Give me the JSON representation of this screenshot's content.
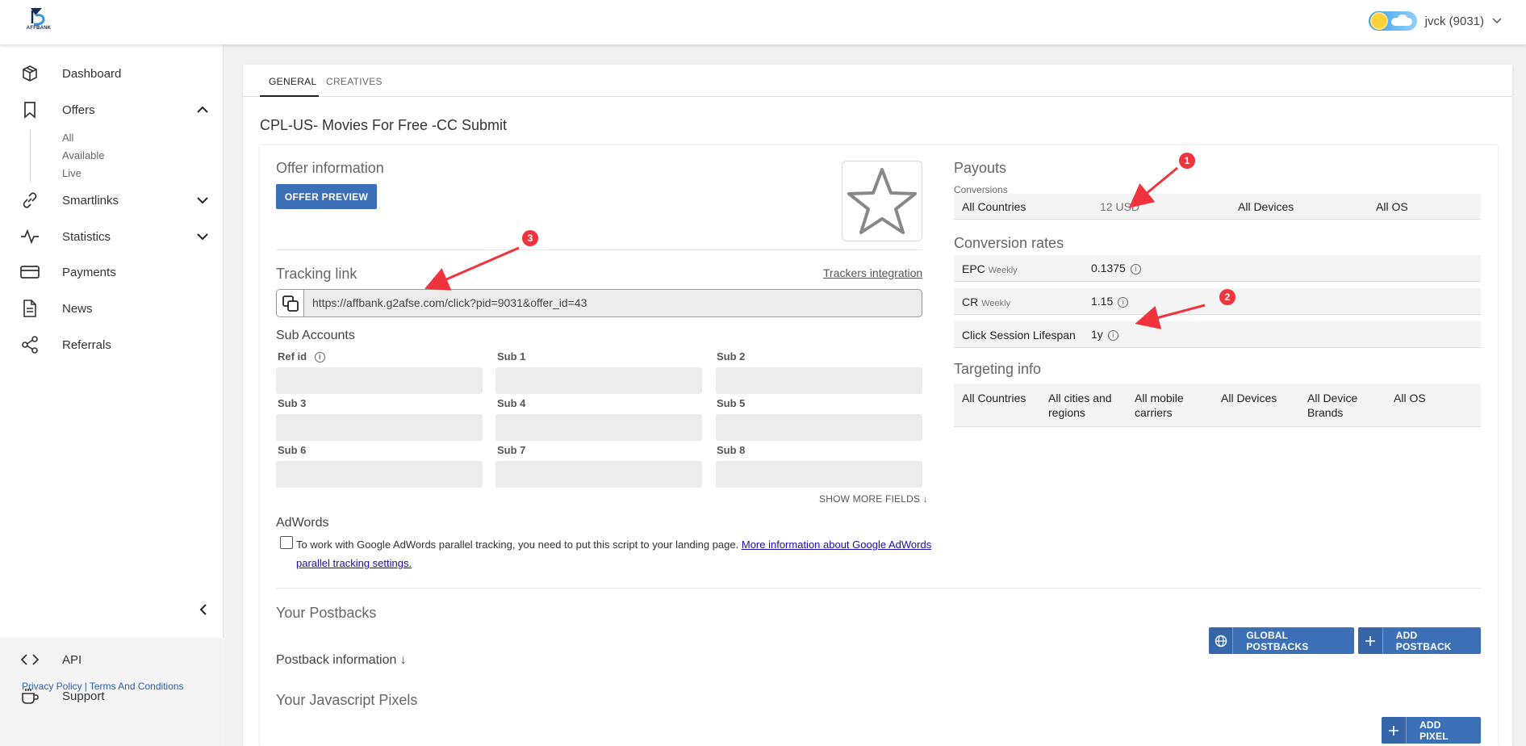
{
  "logo": {
    "text": "AFFBANK"
  },
  "user": {
    "name": "jvck (9031)"
  },
  "sidebar": {
    "items": [
      {
        "label": "Dashboard",
        "icon": "cube-icon"
      },
      {
        "label": "Offers",
        "icon": "bookmark-icon"
      },
      {
        "label": "Smartlinks",
        "icon": "link-icon"
      },
      {
        "label": "Statistics",
        "icon": "activity-icon"
      },
      {
        "label": "Payments",
        "icon": "credit-card-icon"
      },
      {
        "label": "News",
        "icon": "document-icon"
      },
      {
        "label": "Referrals",
        "icon": "share-icon"
      }
    ],
    "offers_sub": [
      "All",
      "Available",
      "Live"
    ],
    "bottom": [
      {
        "label": "API",
        "icon": "code-icon"
      },
      {
        "label": "Support",
        "icon": "coffee-icon"
      }
    ],
    "footer": {
      "privacy": "Privacy Policy",
      "sep": "|",
      "terms": "Terms And Conditions"
    }
  },
  "tabs": [
    "GENERAL",
    "CREATIVES"
  ],
  "offer": {
    "title": "CPL-US- Movies For Free -CC Submit"
  },
  "offer_info": {
    "heading": "Offer information",
    "preview_button": "OFFER PREVIEW"
  },
  "tracking": {
    "heading": "Tracking link",
    "integration_link": "Trackers integration",
    "url": "https://affbank.g2afse.com/click?pid=9031&offer_id=43"
  },
  "sub_accounts": {
    "heading": "Sub Accounts",
    "fields": [
      "Ref id",
      "Sub 1",
      "Sub 2",
      "Sub 3",
      "Sub 4",
      "Sub 5",
      "Sub 6",
      "Sub 7",
      "Sub 8"
    ],
    "show_more": "SHOW MORE FIELDS"
  },
  "adwords": {
    "heading": "AdWords",
    "text": "To work with Google AdWords parallel tracking, you need to put this script to your landing page.",
    "link": "More information about Google AdWords parallel tracking settings."
  },
  "payouts": {
    "heading": "Payouts",
    "subheading": "Conversions",
    "row": [
      "All Countries",
      "12 USD",
      "All Devices",
      "All OS"
    ]
  },
  "conversion_rates": {
    "heading": "Conversion rates",
    "epc_label": "EPC",
    "epc_period": "Weekly",
    "epc_value": "0.1375",
    "cr_label": "CR",
    "cr_period": "Weekly",
    "cr_value": "1.15",
    "session_label": "Click Session Lifespan",
    "session_value": "1y"
  },
  "targeting": {
    "heading": "Targeting info",
    "cells": [
      "All Countries",
      "All cities and regions",
      "All mobile carriers",
      "All Devices",
      "All Device Brands",
      "All OS"
    ]
  },
  "postbacks": {
    "heading": "Your Postbacks",
    "global_button": "GLOBAL POSTBACKS",
    "add_button": "ADD POSTBACK",
    "info": "Postback information"
  },
  "pixels": {
    "heading": "Your Javascript Pixels",
    "add_button": "ADD PIXEL"
  },
  "markers": [
    "1",
    "2",
    "3"
  ],
  "colors": {
    "primary": "#3b6fb6",
    "marker": "#f0333c"
  }
}
